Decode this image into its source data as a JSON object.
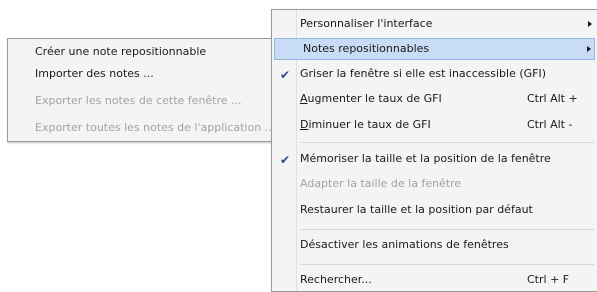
{
  "main_menu": {
    "items": [
      {
        "label": "Personnaliser l'interface"
      },
      {
        "label": "Notes repositionnables"
      },
      {
        "label": "Griser la fenêtre si elle est inaccessible (GFI)"
      },
      {
        "label_accel": "A",
        "label_rest": "ugmenter le taux de GFI",
        "shortcut": "Ctrl Alt +"
      },
      {
        "label_accel": "D",
        "label_rest": "iminuer le taux de GFI",
        "shortcut": "Ctrl Alt -"
      },
      {
        "label": "Mémoriser la taille et la position de la fenêtre"
      },
      {
        "label": "Adapter la taille de la fenêtre"
      },
      {
        "label": "Restaurer la taille et la position par défaut"
      },
      {
        "label": "Désactiver les animations de fenêtres"
      },
      {
        "label": "Rechercher...",
        "shortcut": "Ctrl + F"
      }
    ],
    "check_glyph": "✔"
  },
  "submenu": {
    "items": [
      {
        "label": "Créer une note repositionnable"
      },
      {
        "label": "Importer des notes ..."
      },
      {
        "label": "Exporter les notes de cette fenêtre ..."
      },
      {
        "label": "Exporter toutes les notes de l'application ..."
      }
    ]
  }
}
